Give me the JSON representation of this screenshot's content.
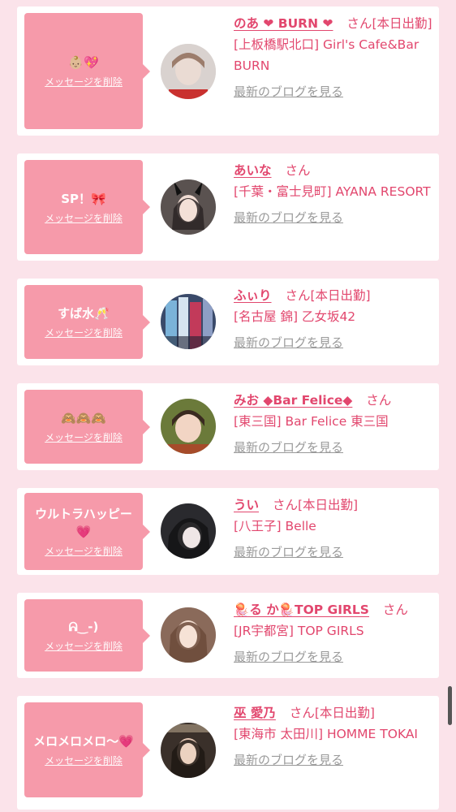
{
  "delete_label": "メッセージを削除",
  "blog_label": "最新のブログを見る",
  "san_label": "さん",
  "accent_color": "#e2476e",
  "bubble_color": "#f69aaa",
  "cards": [
    {
      "message": "👶🏼💖",
      "name": "のあ ❤ BURN ❤",
      "status": "[本日出勤]",
      "store": "[上板橋駅北口] Girl's Cafe&Bar BURN",
      "avatar": "blurred-girl-photo"
    },
    {
      "message": "SP！🎀",
      "name": "あいな",
      "status": "",
      "store": "[千葉・富士見町] AYANA RESORT",
      "avatar": "bunny-ears-girl-photo"
    },
    {
      "message": "すば水🥂",
      "name": "ふぃり",
      "status": "[本日出勤]",
      "store": "[名古屋 錦] 乙女坂42",
      "avatar": "kimono-girl-photo"
    },
    {
      "message": "🙈🙈🙈",
      "name": "みお ◆Bar Felice◆",
      "status": "",
      "store": "[東三国] Bar Felice 東三国",
      "avatar": "girl-photo"
    },
    {
      "message": "ウルトラハッピー💗",
      "name": "うい",
      "status": "[本日出勤]",
      "store": "[八王子] Belle",
      "avatar": "dark-hair-girl-photo"
    },
    {
      "message": "ᕱ‿-)",
      "name": "🪼る か🪼TOP GIRLS",
      "status": "",
      "store": "[JR宇都宮] TOP GIRLS",
      "avatar": "girl-photo"
    },
    {
      "message": "メロメロメロ〜💗",
      "name": "巫 愛乃",
      "status": "[本日出勤]",
      "store": "[東海市 太田川] HOMME TOKAI",
      "avatar": "dark-girl-photo"
    }
  ]
}
